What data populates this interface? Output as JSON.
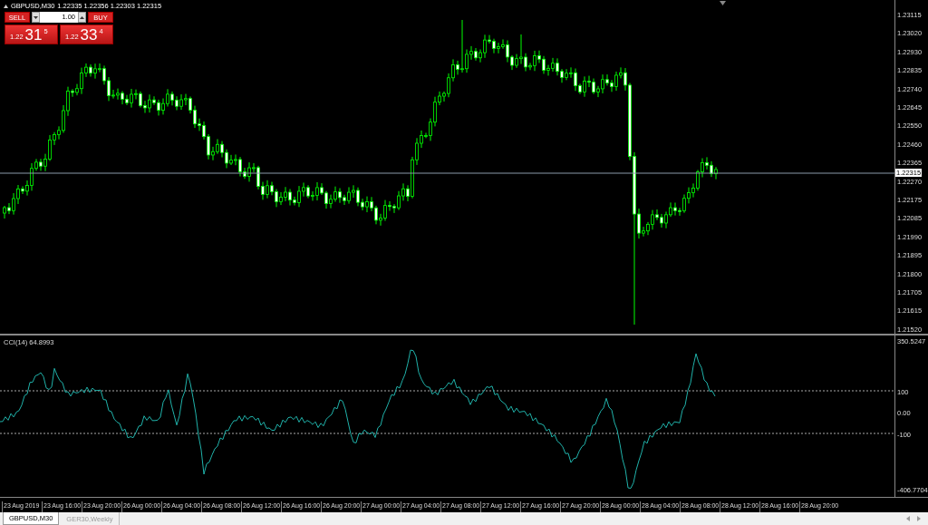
{
  "symbol": {
    "title": "GBPUSD,M30",
    "quote": "1.22335 1.22356 1.22303 1.22315"
  },
  "trade_panel": {
    "sell": "SELL",
    "buy": "BUY",
    "lot": "1.00",
    "bid": {
      "prefix": "1.22",
      "big": "31",
      "small": "5"
    },
    "ask": {
      "prefix": "1.22",
      "big": "33",
      "small": "4"
    }
  },
  "price_axis": {
    "labels": [
      "1.23115",
      "1.23020",
      "1.22930",
      "1.22835",
      "1.22740",
      "1.22645",
      "1.22550",
      "1.22460",
      "1.22365",
      "1.22270",
      "1.22175",
      "1.22085",
      "1.21990",
      "1.21895",
      "1.21800",
      "1.21705",
      "1.21615",
      "1.21520"
    ],
    "current": "1.22315"
  },
  "indicator": {
    "label": "CCI(14) 64.8993",
    "axis_labels": [
      "350.5247",
      "100",
      "0.00",
      "-100",
      "-406.7704"
    ]
  },
  "time_axis": {
    "labels": [
      "23 Aug 2019",
      "23 Aug 16:00",
      "23 Aug 20:00",
      "26 Aug 00:00",
      "26 Aug 04:00",
      "26 Aug 08:00",
      "26 Aug 12:00",
      "26 Aug 16:00",
      "26 Aug 20:00",
      "27 Aug 00:00",
      "27 Aug 04:00",
      "27 Aug 08:00",
      "27 Aug 12:00",
      "27 Aug 16:00",
      "27 Aug 20:00",
      "28 Aug 00:00",
      "28 Aug 04:00",
      "28 Aug 08:00",
      "28 Aug 12:00",
      "28 Aug 16:00",
      "28 Aug 20:00"
    ]
  },
  "tabs": [
    {
      "label": "GBPUSD,M30",
      "selected": true
    },
    {
      "label": "GER30,Weekly",
      "selected": false
    }
  ]
}
